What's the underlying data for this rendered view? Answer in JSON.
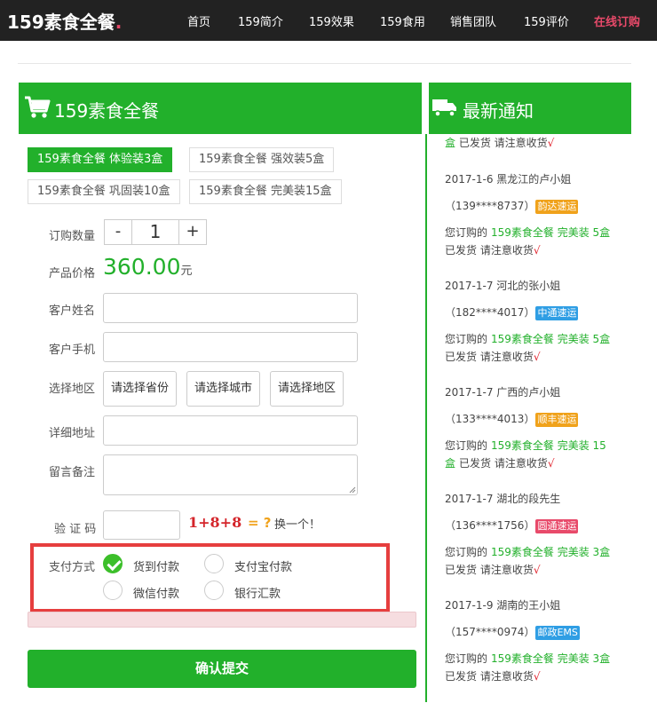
{
  "header": {
    "logo": "159素食全餐",
    "logo_dot": ".",
    "nav": [
      "首页",
      "159简介",
      "159效果",
      "159食用",
      "销售团队",
      "159评价",
      "在线订购"
    ]
  },
  "order": {
    "title": "159素食全餐",
    "packages": [
      "159素食全餐  体验装3盒",
      "159素食全餐   强效装5盒",
      "159素食全餐 巩固装10盒",
      "159素食全餐  完美装15盒"
    ],
    "qty_label": "订购数量",
    "qty_minus": "-",
    "qty_value": "1",
    "qty_plus": "+",
    "price_label": "产品价格",
    "price_value": "360.00",
    "price_unit": "元",
    "name_label": "客户姓名",
    "phone_label": "客户手机",
    "region_label": "选择地区",
    "province": "请选择省份",
    "city": "请选择城市",
    "district": "请选择地区",
    "address_label": "详细地址",
    "note_label": "留言备注",
    "captcha_label": "验 证 码",
    "captcha_expr": "1+8+8",
    "captcha_eq": "= ?",
    "captcha_refresh": "换一个！",
    "payment_label": "支付方式",
    "payment_options": [
      "货到付款",
      "支付宝付款",
      "微信付款",
      "银行汇款"
    ],
    "payment_selected": "货到付款",
    "submit": "确认提交"
  },
  "notices": {
    "title": "最新通知",
    "top_partial": {
      "box": "盒",
      "shipped": "已发货 请注意收货",
      "check": "√"
    },
    "items": [
      {
        "date_name": "2017-1-6 黑龙江的卢小姐",
        "phone": "（139****8737）",
        "courier": "韵达速运",
        "courier_color": "#f0a21b",
        "product_prefix": "您订购的",
        "product": "159素食全餐 完美装 5盒",
        "product_wrap": "",
        "shipped": "已发货 请注意收货",
        "check": "√"
      },
      {
        "date_name": "2017-1-7 河北的张小姐",
        "phone": "（182****4017）",
        "courier": "中通速运",
        "courier_color": "#2f9ee4",
        "product_prefix": "您订购的",
        "product": "159素食全餐 完美装 5盒",
        "product_wrap": "",
        "shipped": "已发货 请注意收货",
        "check": "√"
      },
      {
        "date_name": "2017-1-7 广西的卢小姐",
        "phone": "（133****4013）",
        "courier": "顺丰速运",
        "courier_color": "#f0a21b",
        "product_prefix": "您订购的",
        "product": "159素食全餐 完美装 15",
        "product_wrap": "盒",
        "shipped": "已发货 请注意收货",
        "check": "√"
      },
      {
        "date_name": "2017-1-7 湖北的段先生",
        "phone": "（136****1756）",
        "courier": "圆通速运",
        "courier_color": "#e84a6a",
        "product_prefix": "您订购的",
        "product": "159素食全餐 完美装 3盒",
        "product_wrap": "",
        "shipped": "已发货 请注意收货",
        "check": "√"
      },
      {
        "date_name": "2017-1-9 湖南的王小姐",
        "phone": "（157****0974）",
        "courier": "邮政EMS",
        "courier_color": "#2f9ee4",
        "product_prefix": "您订购的",
        "product": "159素食全餐 完美装 3盒",
        "product_wrap": "",
        "shipped": "已发货 请注意收货",
        "check": "√"
      }
    ]
  }
}
